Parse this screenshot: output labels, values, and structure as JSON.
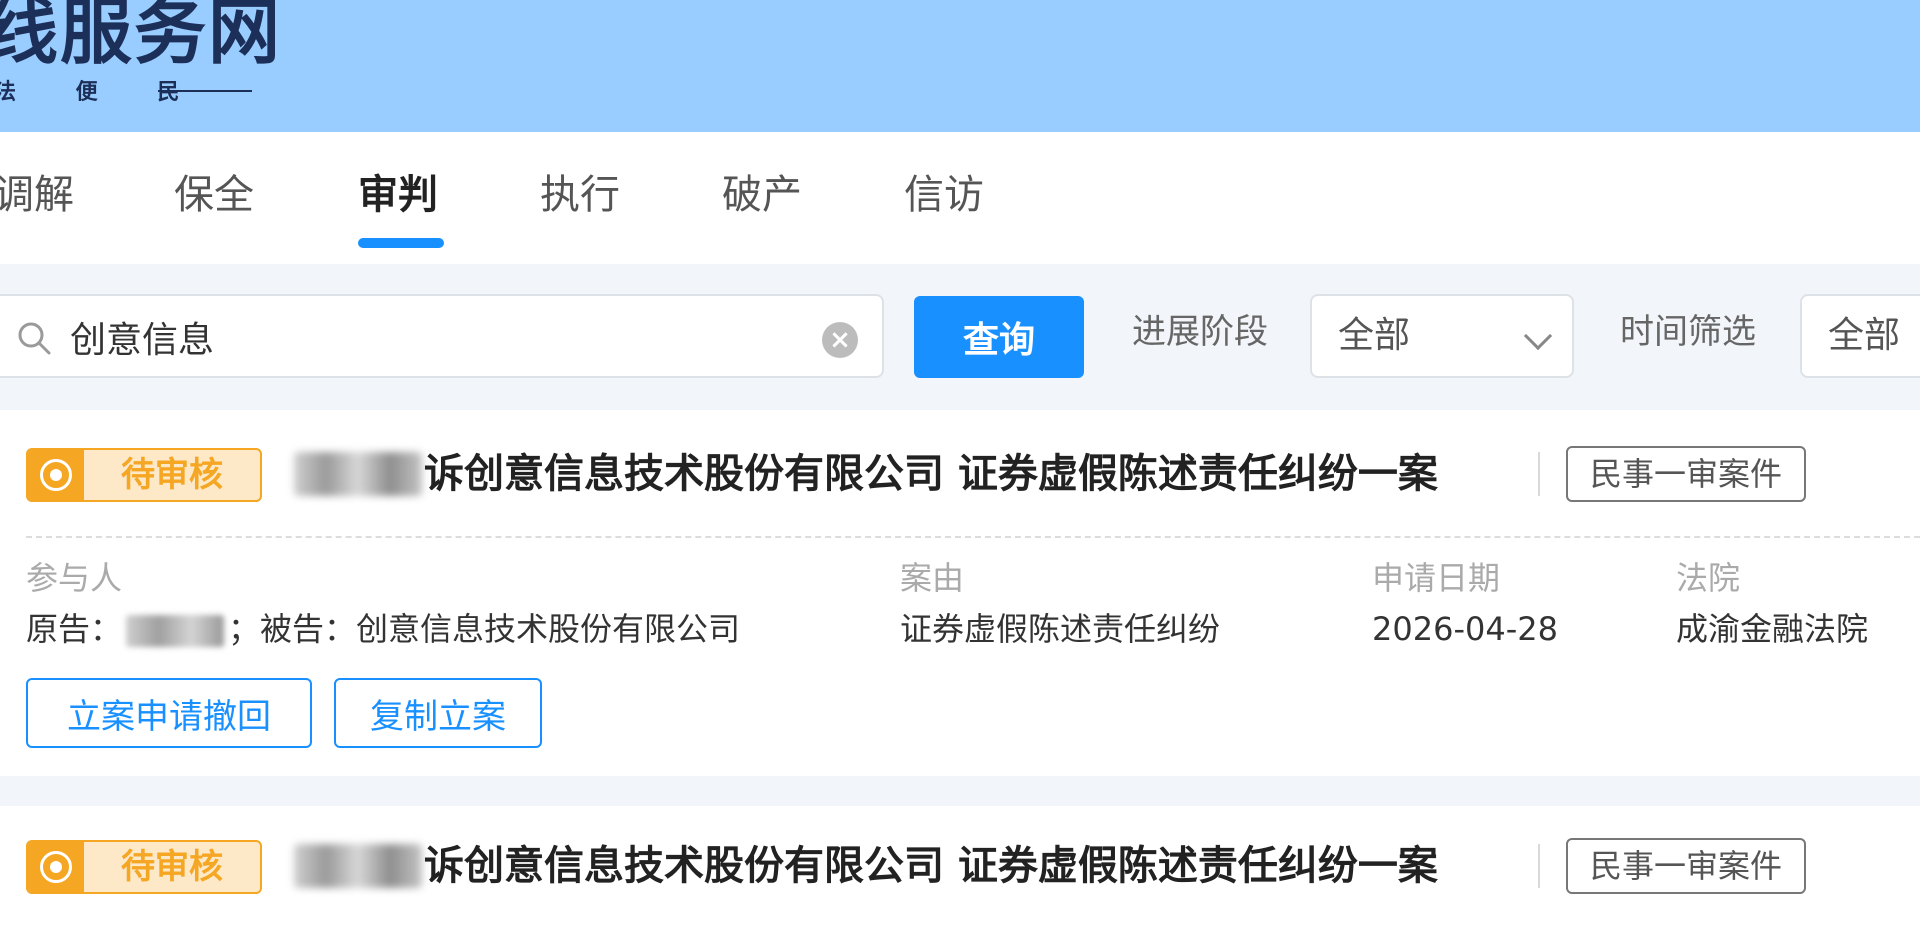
{
  "header": {
    "site_title": "线服务网",
    "slogan": "法 便 民"
  },
  "tabs": [
    {
      "label": "调解"
    },
    {
      "label": "保全"
    },
    {
      "label": "审判"
    },
    {
      "label": "执行"
    },
    {
      "label": "破产"
    },
    {
      "label": "信访"
    }
  ],
  "active_tab": "审判",
  "filters": {
    "search_value": "创意信息",
    "query_label": "查询",
    "stage_label": "进展阶段",
    "stage_value": "全部",
    "time_label": "时间筛选",
    "time_value": "全部"
  },
  "cases": [
    {
      "status": "待审核",
      "title": "诉创意信息技术股份有限公司 证券虚假陈述责任纠纷一案",
      "type_tag": "民事一审案件",
      "participants_label": "参与人",
      "plaintiff_prefix": "原告：",
      "defendant_text": "；被告：创意信息技术股份有限公司",
      "cause_label": "案由",
      "cause_value": "证券虚假陈述责任纠纷",
      "date_label": "申请日期",
      "date_value": "2026-04-28",
      "court_label": "法院",
      "court_value": "成渝金融法院",
      "actions": [
        "立案申请撤回",
        "复制立案"
      ]
    },
    {
      "status": "待审核",
      "title": "诉创意信息技术股份有限公司 证券虚假陈述责任纠纷一案",
      "type_tag": "民事一审案件"
    }
  ],
  "colors": {
    "header_bg": "#99ccff",
    "primary": "#1890ff",
    "pending": "#f5a623"
  }
}
